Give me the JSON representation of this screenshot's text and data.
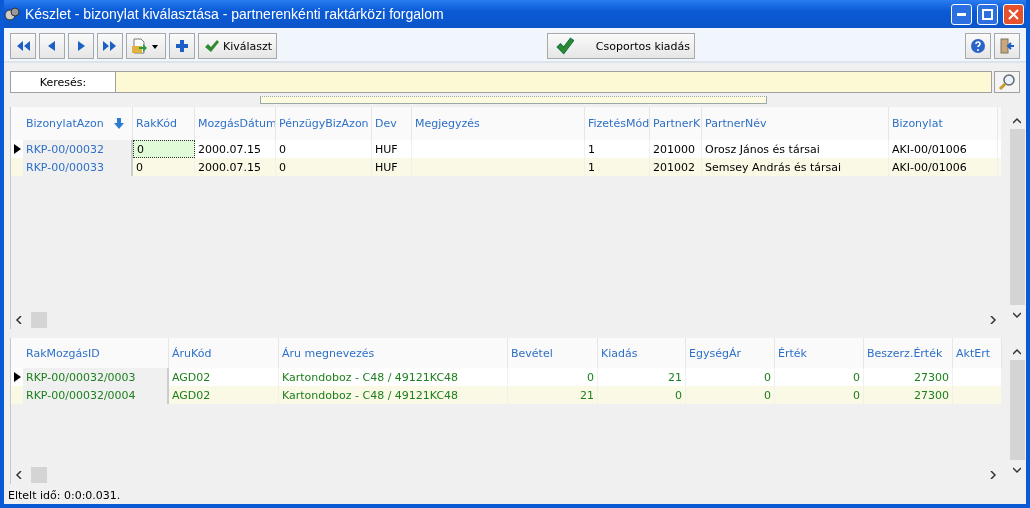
{
  "window": {
    "title": "Készlet - bizonylat kiválasztása - partnerenkénti raktárközi forgalom"
  },
  "toolbar": {
    "buttons": [
      {
        "kind": "first"
      },
      {
        "kind": "prev"
      },
      {
        "kind": "next"
      },
      {
        "kind": "last"
      },
      {
        "kind": "export"
      },
      {
        "kind": "add"
      },
      {
        "kind": "select",
        "label": "Kiválaszt"
      }
    ],
    "group_button": {
      "label": "Csoportos kiadás"
    },
    "right_buttons": [
      {
        "kind": "help"
      },
      {
        "kind": "exit"
      }
    ]
  },
  "search": {
    "label": "Keresés:"
  },
  "master_table": {
    "columns": [
      {
        "label": "BizonylatAzon",
        "kind": "text",
        "sorted": true
      },
      {
        "label": "RakKód",
        "kind": "text",
        "focused": true
      },
      {
        "label": "MozgásDátum",
        "kind": "text"
      },
      {
        "label": "PénzügyBizAzon",
        "kind": "text"
      },
      {
        "label": "Dev",
        "kind": "text"
      },
      {
        "label": "Megjegyzés",
        "kind": "text"
      },
      {
        "label": "FizetésMód",
        "kind": "text"
      },
      {
        "label": "PartnerK",
        "kind": "text"
      },
      {
        "label": "PartnerNév",
        "kind": "text"
      },
      {
        "label": "Bizonylat",
        "kind": "text"
      }
    ],
    "rows": [
      {
        "selected": true,
        "cells": [
          "RKP-00/00032",
          "0",
          "2000.07.15",
          "0",
          "HUF",
          "",
          "1",
          "201000",
          "Orosz János és társai",
          "AKI-00/01006"
        ]
      },
      {
        "selected": false,
        "cells": [
          "RKP-00/00033",
          "0",
          "2000.07.15",
          "0",
          "HUF",
          "",
          "1",
          "201002",
          "Semsey András és társai",
          "AKI-00/01006"
        ]
      }
    ]
  },
  "detail_table": {
    "columns": [
      {
        "label": "RakMozgásID",
        "kind": "text"
      },
      {
        "label": "ÁruKód",
        "kind": "text"
      },
      {
        "label": "Áru megnevezés",
        "kind": "text"
      },
      {
        "label": "Bevétel",
        "kind": "number"
      },
      {
        "label": "Kiadás",
        "kind": "number"
      },
      {
        "label": "EgységÁr",
        "kind": "number"
      },
      {
        "label": "Érték",
        "kind": "number"
      },
      {
        "label": "Beszerz.Érték",
        "kind": "number"
      },
      {
        "label": "AktErt",
        "kind": "number"
      }
    ],
    "rows": [
      {
        "selected": true,
        "cells": [
          "RKP-00/00032/0003",
          "AGD02",
          "Kartondoboz - C48 / 49121KC48",
          "0",
          "21",
          "0",
          "0",
          "27300",
          ""
        ]
      },
      {
        "selected": false,
        "cells": [
          "RKP-00/00032/0004",
          "AGD02",
          "Kartondoboz - C48 / 49121KC48",
          "21",
          "0",
          "0",
          "0",
          "27300",
          ""
        ]
      }
    ]
  },
  "status_bar": {
    "text": "Eltelt idő: 0:0:0.031."
  }
}
